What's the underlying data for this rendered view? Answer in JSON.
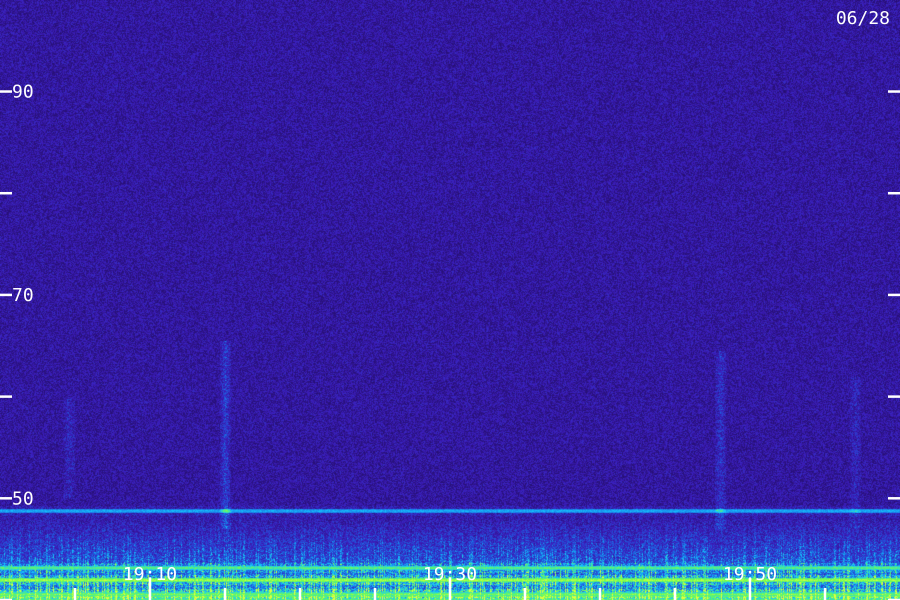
{
  "chart_data": {
    "type": "heatmap",
    "title": "",
    "date_label": "06/28",
    "xlabel": "",
    "ylabel": "",
    "ylim": [
      40,
      99
    ],
    "y_ticks": [
      {
        "value": 90,
        "label": "90"
      },
      {
        "value": 80,
        "label": ""
      },
      {
        "value": 70,
        "label": "70"
      },
      {
        "value": 60,
        "label": ""
      },
      {
        "value": 50,
        "label": "50"
      },
      {
        "value": 40,
        "label": ""
      }
    ],
    "x_range_minutes": [
      0,
      60
    ],
    "x_ticks": [
      {
        "minute": 2.5,
        "label": ""
      },
      {
        "minute": 5,
        "label": "19:10"
      },
      {
        "minute": 7.5,
        "label": ""
      },
      {
        "minute": 10,
        "label": ""
      },
      {
        "minute": 12.5,
        "label": ""
      },
      {
        "minute": 15,
        "label": "19:30"
      },
      {
        "minute": 17.5,
        "label": ""
      },
      {
        "minute": 20,
        "label": ""
      },
      {
        "minute": 22.5,
        "label": ""
      },
      {
        "minute": 25,
        "label": "19:50"
      },
      {
        "minute": 27.5,
        "label": ""
      }
    ],
    "colors": {
      "background": "#1a0a55",
      "noise": "#3a1a99",
      "mid": "#1e5fd0",
      "high": "#12e0ff",
      "peak": "#7dff3a"
    },
    "bands": [
      {
        "value": 48.8,
        "intensity": 0.55
      },
      {
        "value": 43.2,
        "intensity": 0.85
      },
      {
        "value": 42.0,
        "intensity": 1.0
      },
      {
        "value": 40.6,
        "intensity": 0.9
      },
      {
        "value": 40.0,
        "intensity": 0.9
      }
    ],
    "vertical_streaks": [
      {
        "minute": 7.5,
        "from": 47,
        "to": 65.5,
        "intensity": 0.55
      },
      {
        "minute": 24.0,
        "from": 47,
        "to": 64.5,
        "intensity": 0.4
      },
      {
        "minute": 2.3,
        "from": 50,
        "to": 60,
        "intensity": 0.2
      },
      {
        "minute": 28.5,
        "from": 47,
        "to": 62,
        "intensity": 0.18
      }
    ]
  }
}
